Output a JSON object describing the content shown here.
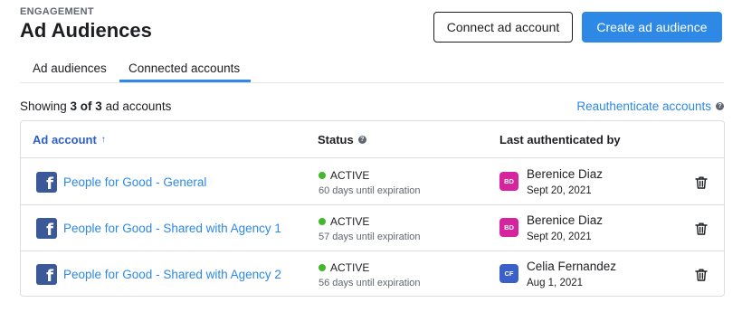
{
  "header": {
    "overline": "ENGAGEMENT",
    "title": "Ad Audiences",
    "connect_button": "Connect ad account",
    "create_button": "Create ad audience"
  },
  "tabs": [
    {
      "label": "Ad audiences",
      "active": false
    },
    {
      "label": "Connected accounts",
      "active": true
    }
  ],
  "summary": {
    "prefix": "Showing ",
    "count": "3 of 3",
    "suffix": " ad accounts",
    "reauth_link": "Reauthenticate accounts"
  },
  "table": {
    "columns": {
      "account": "Ad account",
      "status": "Status",
      "last_auth": "Last authenticated by"
    },
    "rows": [
      {
        "account": "People for Good - General",
        "status": "ACTIVE",
        "expiration": "60 days until expiration",
        "initials": "BD",
        "avatar_color": "#d6249f",
        "person": "Berenice Diaz",
        "date": "Sept 20, 2021"
      },
      {
        "account": "People for Good - Shared with Agency 1",
        "status": "ACTIVE",
        "expiration": "57 days until expiration",
        "initials": "BD",
        "avatar_color": "#d6249f",
        "person": "Berenice Diaz",
        "date": "Sept 20, 2021"
      },
      {
        "account": "People for Good - Shared with Agency 2",
        "status": "ACTIVE",
        "expiration": "56 days until expiration",
        "initials": "CF",
        "avatar_color": "#3b5fc9",
        "person": "Celia Fernandez",
        "date": "Aug 1, 2021"
      }
    ]
  },
  "colors": {
    "primary": "#2d88e6",
    "active_status": "#42b72a",
    "facebook": "#3b5998"
  },
  "icons": {
    "account": "facebook-icon",
    "delete": "trash-icon",
    "help": "help-icon",
    "sort": "sort-up-icon"
  }
}
